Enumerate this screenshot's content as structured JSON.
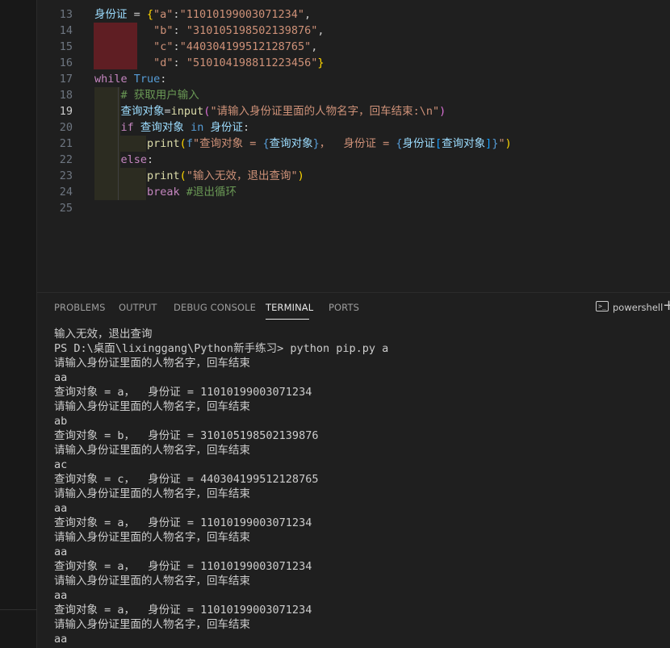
{
  "editor": {
    "lines": [
      {
        "num": "13",
        "tokens": [
          [
            "var",
            "身份证"
          ],
          [
            "punc",
            " = "
          ],
          [
            "brace",
            "{"
          ],
          [
            "str",
            "\"a\""
          ],
          [
            "punc",
            ":"
          ],
          [
            "str",
            "\"11010199003071234\""
          ],
          [
            "punc",
            ","
          ]
        ]
      },
      {
        "num": "14",
        "tokens": [
          [
            "punc",
            "         "
          ],
          [
            "str",
            "\"b\""
          ],
          [
            "punc",
            ": "
          ],
          [
            "str",
            "\"310105198502139876\""
          ],
          [
            "punc",
            ","
          ]
        ]
      },
      {
        "num": "15",
        "tokens": [
          [
            "punc",
            "         "
          ],
          [
            "str",
            "\"c\""
          ],
          [
            "punc",
            ":"
          ],
          [
            "str",
            "\"440304199512128765\""
          ],
          [
            "punc",
            ","
          ]
        ]
      },
      {
        "num": "16",
        "tokens": [
          [
            "punc",
            "         "
          ],
          [
            "str",
            "\"d\""
          ],
          [
            "punc",
            ": "
          ],
          [
            "str",
            "\"510104198811223456\""
          ],
          [
            "brace",
            "}"
          ]
        ]
      },
      {
        "num": "17",
        "tokens": [
          [
            "kw",
            "while"
          ],
          [
            "punc",
            " "
          ],
          [
            "kwb",
            "True"
          ],
          [
            "punc",
            ":"
          ]
        ]
      },
      {
        "num": "18",
        "tokens": [
          [
            "punc",
            "    "
          ],
          [
            "cmt",
            "# 获取用户输入"
          ]
        ]
      },
      {
        "num": "19",
        "active": true,
        "tokens": [
          [
            "punc",
            "    "
          ],
          [
            "var",
            "查询对象"
          ],
          [
            "punc",
            "="
          ],
          [
            "fn",
            "input"
          ],
          [
            "brace2",
            "("
          ],
          [
            "str",
            "\"请输入身份证里面的人物名字，回车结束:\\n\""
          ],
          [
            "brace2",
            ")"
          ]
        ]
      },
      {
        "num": "20",
        "tokens": [
          [
            "punc",
            "    "
          ],
          [
            "kw",
            "if"
          ],
          [
            "punc",
            " "
          ],
          [
            "var",
            "查询对象"
          ],
          [
            "punc",
            " "
          ],
          [
            "kwb",
            "in"
          ],
          [
            "punc",
            " "
          ],
          [
            "var",
            "身份证"
          ],
          [
            "punc",
            ":"
          ]
        ]
      },
      {
        "num": "21",
        "tokens": [
          [
            "punc",
            "        "
          ],
          [
            "fn",
            "print"
          ],
          [
            "brace",
            "("
          ],
          [
            "kwb",
            "f"
          ],
          [
            "str",
            "\"查询对象 = "
          ],
          [
            "kwb",
            "{"
          ],
          [
            "var",
            "查询对象"
          ],
          [
            "kwb",
            "}"
          ],
          [
            "str",
            "，  身份证 = "
          ],
          [
            "kwb",
            "{"
          ],
          [
            "var",
            "身份证"
          ],
          [
            "brace3",
            "["
          ],
          [
            "var",
            "查询对象"
          ],
          [
            "brace3",
            "]"
          ],
          [
            "kwb",
            "}"
          ],
          [
            "str",
            "\""
          ],
          [
            "brace",
            ")"
          ]
        ]
      },
      {
        "num": "22",
        "tokens": [
          [
            "punc",
            "    "
          ],
          [
            "kw",
            "else"
          ],
          [
            "punc",
            ":"
          ]
        ]
      },
      {
        "num": "23",
        "tokens": [
          [
            "punc",
            "        "
          ],
          [
            "fn",
            "print"
          ],
          [
            "brace",
            "("
          ],
          [
            "str",
            "\"输入无效，退出查询\""
          ],
          [
            "brace",
            ")"
          ]
        ]
      },
      {
        "num": "24",
        "tokens": [
          [
            "punc",
            "        "
          ],
          [
            "kw",
            "break"
          ],
          [
            "punc",
            " "
          ],
          [
            "cmt",
            "#退出循环"
          ]
        ]
      },
      {
        "num": "25",
        "tokens": []
      }
    ]
  },
  "panel": {
    "tabs": {
      "problems": "PROBLEMS",
      "output": "OUTPUT",
      "debug_console": "DEBUG CONSOLE",
      "terminal": "TERMINAL",
      "ports": "PORTS"
    },
    "shell_label": "powershell",
    "shell_icon_glyph": ">_",
    "add_glyph": "+"
  },
  "terminal": {
    "lines": [
      "输入无效，退出查询",
      "PS D:\\桌面\\lixinggang\\Python新手练习> python pip.py a",
      "请输入身份证里面的人物名字，回车结束",
      "aa",
      "查询对象 = a，  身份证 = 11010199003071234",
      "请输入身份证里面的人物名字，回车结束",
      "ab",
      "查询对象 = b，  身份证 = 310105198502139876",
      "请输入身份证里面的人物名字，回车结束",
      "ac",
      "查询对象 = c，  身份证 = 440304199512128765",
      "请输入身份证里面的人物名字，回车结束",
      "aa",
      "查询对象 = a，  身份证 = 11010199003071234",
      "请输入身份证里面的人物名字，回车结束",
      "aa",
      "查询对象 = a，  身份证 = 11010199003071234",
      "请输入身份证里面的人物名字，回车结束",
      "aa",
      "查询对象 = a，  身份证 = 11010199003071234",
      "请输入身份证里面的人物名字，回车结束",
      "aa"
    ]
  }
}
